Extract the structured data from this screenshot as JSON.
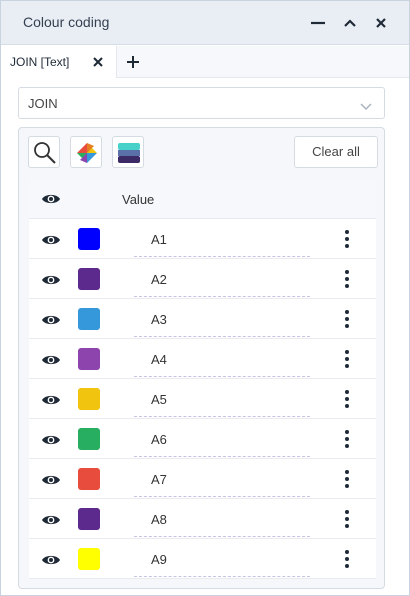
{
  "window": {
    "title": "Colour coding"
  },
  "tabs": [
    {
      "label": "JOIN [Text]"
    }
  ],
  "dropdown": {
    "value": "JOIN"
  },
  "toolbar": {
    "clear_label": "Clear all"
  },
  "table": {
    "header_value": "Value",
    "rows": [
      {
        "value": "A1",
        "color": "#0000ff"
      },
      {
        "value": "A2",
        "color": "#5b2a8c"
      },
      {
        "value": "A3",
        "color": "#3498db"
      },
      {
        "value": "A4",
        "color": "#8e44ad"
      },
      {
        "value": "A5",
        "color": "#f1c40f"
      },
      {
        "value": "A6",
        "color": "#27ae60"
      },
      {
        "value": "A7",
        "color": "#e74c3c"
      },
      {
        "value": "A8",
        "color": "#5b2a8c"
      },
      {
        "value": "A9",
        "color": "#ffff00"
      }
    ]
  },
  "icons": {
    "window_buttons": [
      "minimize-icon",
      "maximize-icon",
      "close-icon"
    ],
    "tab": [
      "close-icon",
      "plus-icon"
    ],
    "toolbar": [
      "search-icon",
      "palette-icon",
      "gradient-icon"
    ],
    "rows": [
      "eye-icon",
      "more-vertical-icon"
    ]
  },
  "colors": {
    "titlebar": "#e9eef5",
    "content_bg": "#f5f7fa",
    "border": "#d5dbe3"
  }
}
